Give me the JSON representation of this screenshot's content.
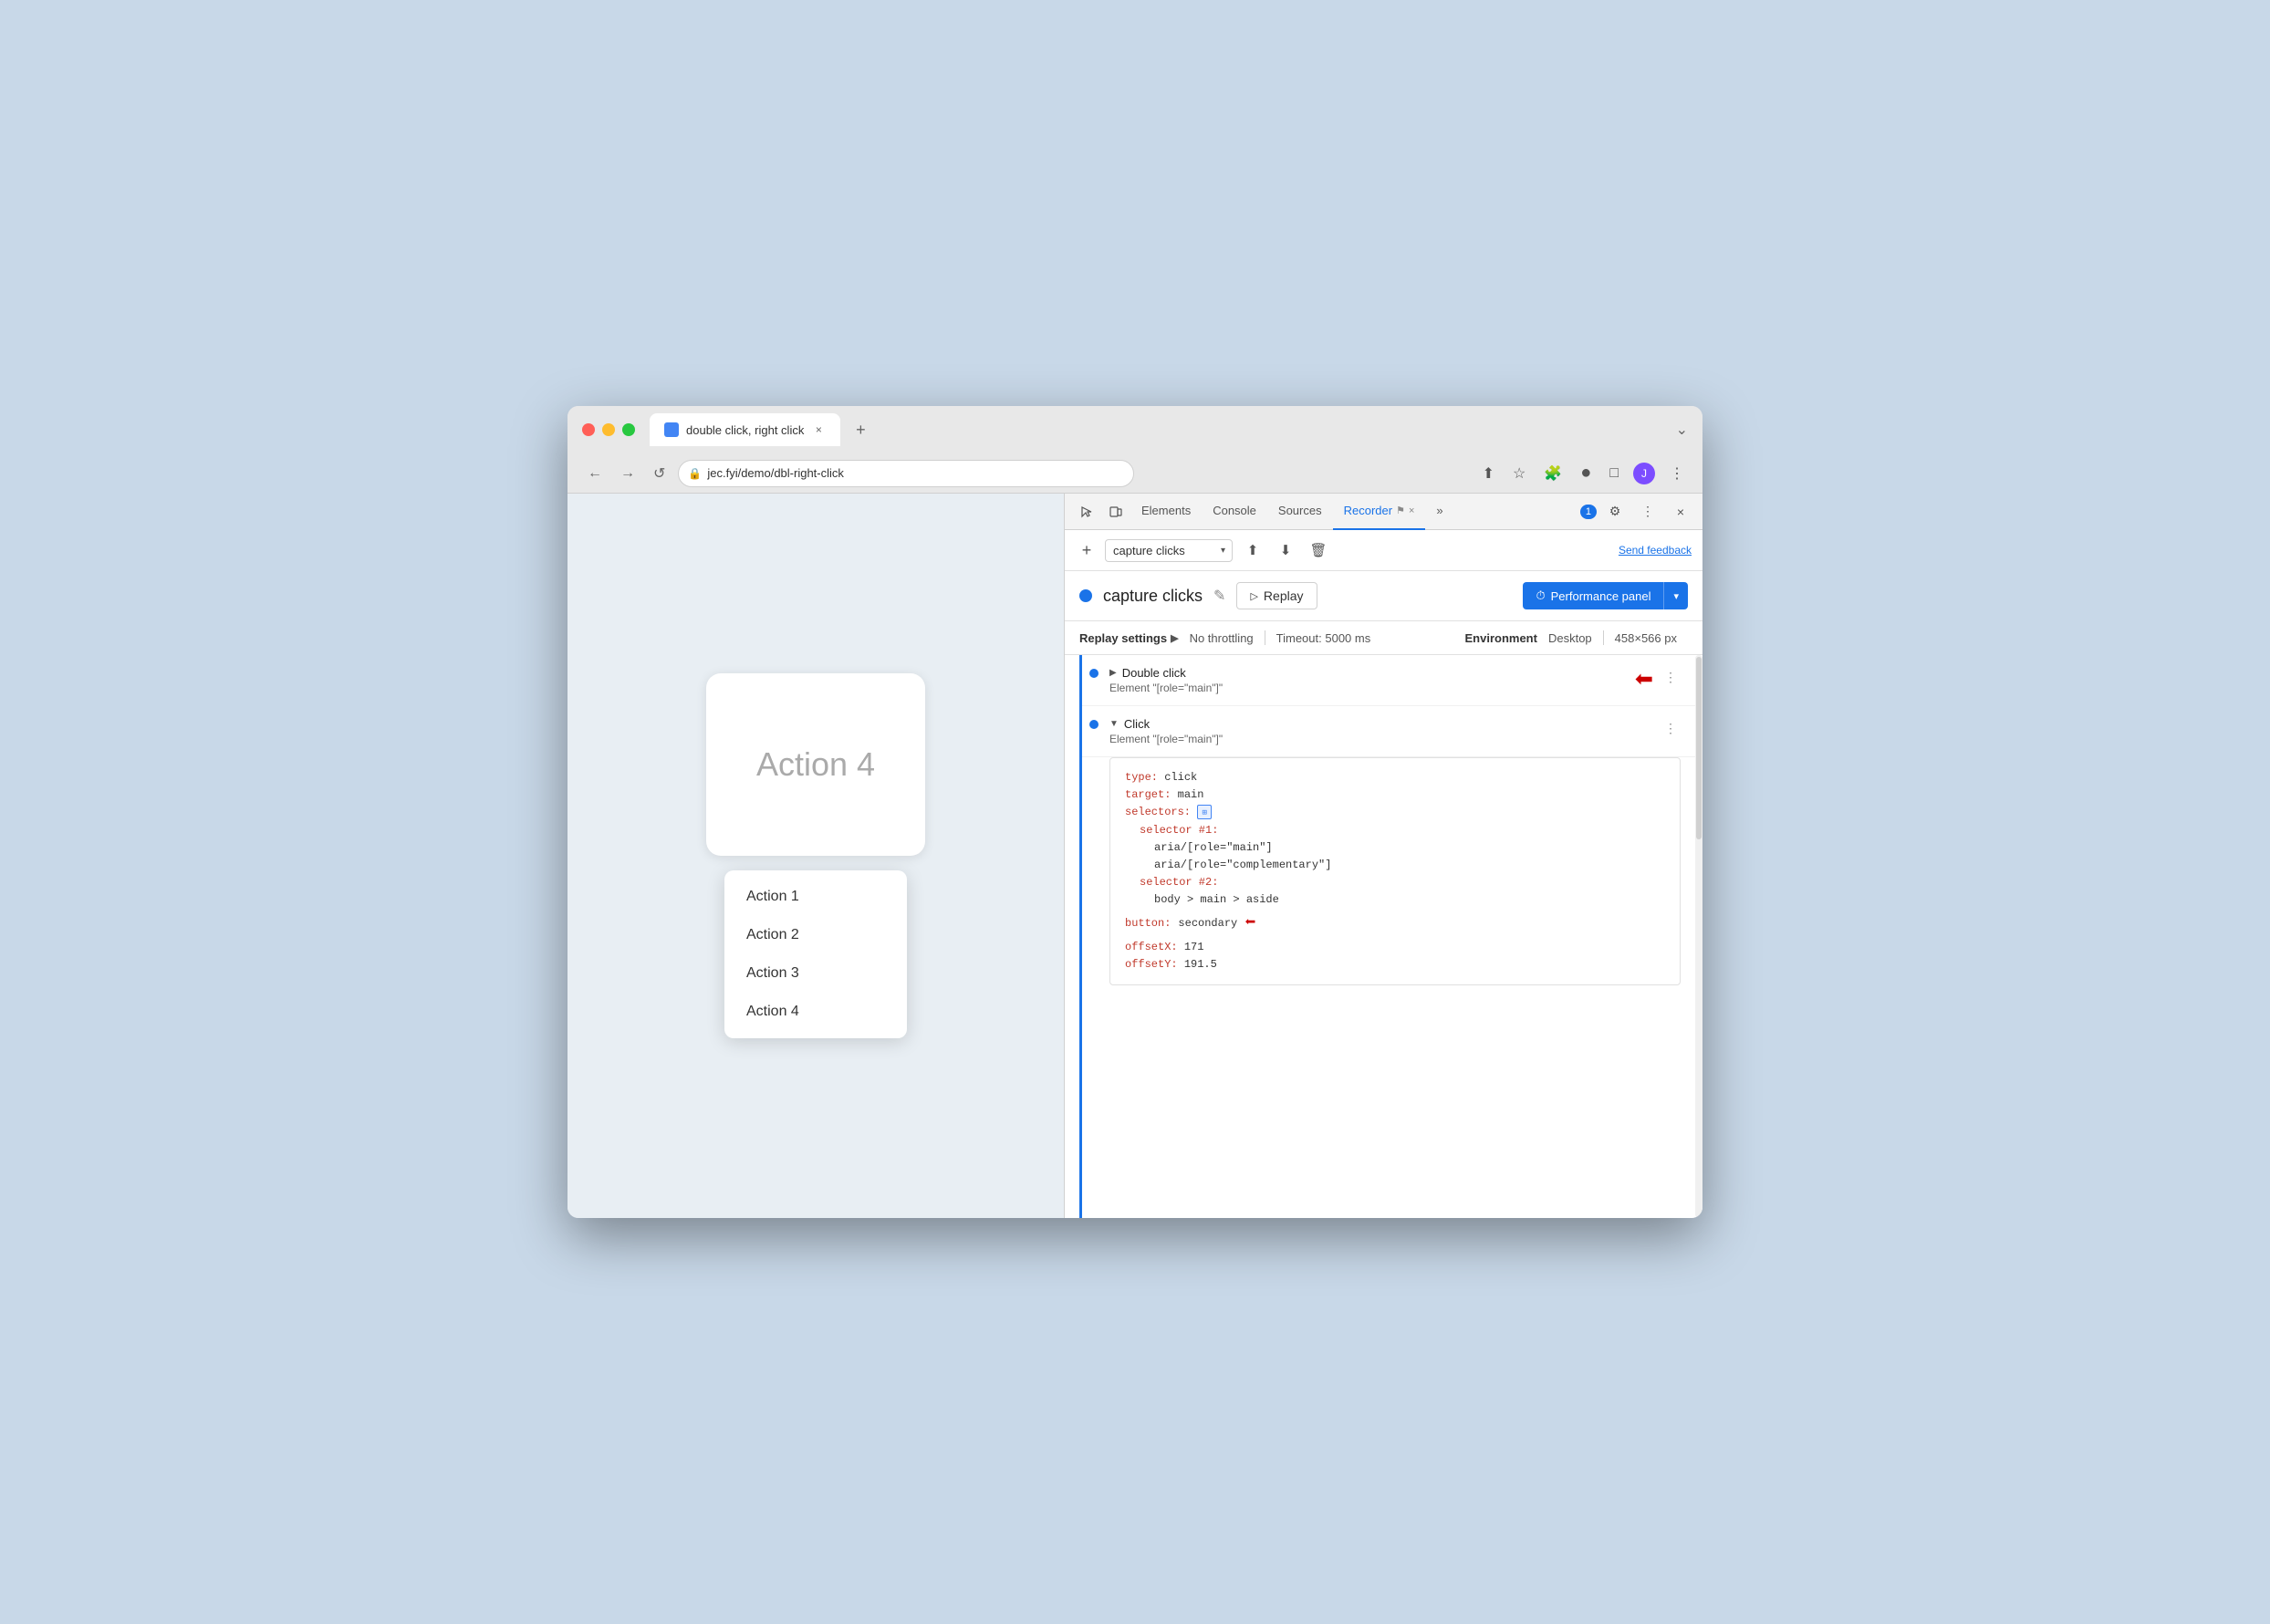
{
  "browser": {
    "tab_title": "double click, right click",
    "tab_close": "×",
    "tab_new": "+",
    "url": "jec.fyi/demo/dbl-right-click",
    "window_menu": "⌄"
  },
  "nav": {
    "back": "←",
    "forward": "→",
    "refresh": "↺",
    "toolbar_icons": [
      "⬆",
      "☆",
      "🧩",
      "⎋",
      "□",
      "👤",
      "⋮"
    ]
  },
  "devtools": {
    "tabs": [
      "Elements",
      "Console",
      "Sources",
      "Recorder",
      "»"
    ],
    "active_tab": "Recorder",
    "recorder_dot": "",
    "tab_close": "×",
    "badge": "1",
    "gear": "⚙",
    "more": "⋮",
    "close": "×"
  },
  "recorder": {
    "add_btn": "+",
    "recording_name": "capture clicks",
    "recording_select_placeholder": "capture clicks",
    "send_feedback": "Send feedback",
    "replay_label": "Replay",
    "perf_panel_label": "Performance panel",
    "perf_arrow": "▾",
    "edit_icon": "✎",
    "indicator_color": "#1a73e8"
  },
  "settings": {
    "replay_label": "Replay settings",
    "replay_arrow": "▶",
    "no_throttling": "No throttling",
    "timeout": "Timeout: 5000 ms",
    "env_label": "Environment",
    "env_value": "Desktop",
    "env_size": "458×566 px"
  },
  "actions": [
    {
      "id": "action1",
      "expanded": false,
      "triangle": "▶",
      "title": "Double click",
      "subtitle": "Element \"[role=\"main\"]\"",
      "has_red_arrow": true,
      "more": "⋮",
      "code": null
    },
    {
      "id": "action2",
      "expanded": true,
      "triangle": "▼",
      "title": "Click",
      "subtitle": "Element \"[role=\"main\"]\"",
      "has_red_arrow": false,
      "more": "⋮",
      "code": {
        "type_key": "type:",
        "type_val": "click",
        "target_key": "target:",
        "target_val": "main",
        "selectors_key": "selectors:",
        "selector1_key": "selector #1:",
        "aria1": "aria/[role=\"main\"]",
        "aria2": "aria/[role=\"complementary\"]",
        "selector2_key": "selector #2:",
        "body_val": "body > main > aside",
        "button_key": "button:",
        "button_val": "secondary",
        "offsetX_key": "offsetX:",
        "offsetX_val": "171",
        "offsetY_key": "offsetY:",
        "offsetY_val": "191.5"
      },
      "has_red_arrow_code": true
    }
  ],
  "webpage": {
    "main_card_text": "Action 4",
    "menu_items": [
      "Action 1",
      "Action 2",
      "Action 3",
      "Action 4"
    ]
  }
}
